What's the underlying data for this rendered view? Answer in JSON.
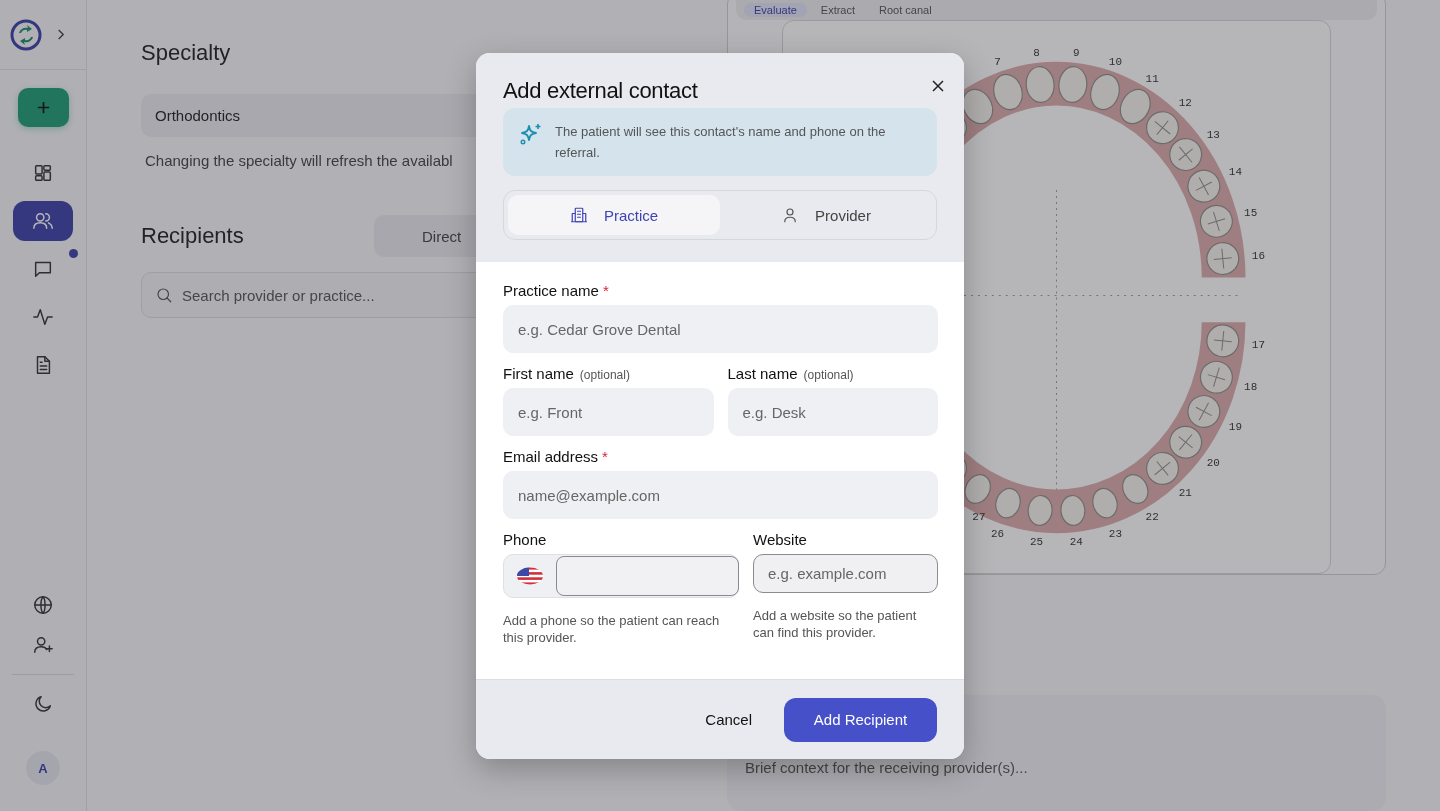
{
  "sidebar": {
    "nav": [
      {
        "kind": "dashboard",
        "selected": false,
        "badge": false
      },
      {
        "kind": "contacts",
        "selected": true,
        "badge": false
      },
      {
        "kind": "messages",
        "selected": false,
        "badge": true
      },
      {
        "kind": "activity",
        "selected": false,
        "badge": false
      },
      {
        "kind": "documents",
        "selected": false,
        "badge": false
      }
    ],
    "utility": [
      {
        "kind": "language"
      },
      {
        "kind": "invite"
      }
    ],
    "avatar": "A"
  },
  "specialty": {
    "title": "Specialty",
    "value": "Orthodontics",
    "help": "Changing the specialty will refresh the availabl"
  },
  "recipients": {
    "title": "Recipients",
    "mode": "Direct",
    "search_placeholder": "Search provider or practice..."
  },
  "treatment_tabs": [
    {
      "label": "Evaluate",
      "selected": true
    },
    {
      "label": "Extract",
      "selected": false
    },
    {
      "label": "Root canal",
      "selected": false
    }
  ],
  "tooth_chart": {
    "upper_numbers": [
      "7",
      "8",
      "9",
      "10",
      "11",
      "12",
      "13",
      "14",
      "15",
      "16"
    ],
    "lower_numbers": [
      "17",
      "18",
      "19",
      "20",
      "21",
      "22",
      "23",
      "24",
      "25",
      "26",
      "27"
    ]
  },
  "notes": {
    "placeholder": "Brief context for the receiving provider(s)..."
  },
  "dialog": {
    "title": "Add external contact",
    "notice": "The patient will see this contact's name and phone on the referral.",
    "required_mark": "*",
    "types": [
      {
        "kind": "practice",
        "label": "Practice",
        "selected": true
      },
      {
        "kind": "provider",
        "label": "Provider",
        "selected": false
      }
    ],
    "rows": [
      [
        {
          "kind": "text",
          "label": "Practice name",
          "required": true,
          "placeholder": "e.g. Cedar Grove Dental"
        }
      ],
      [
        {
          "kind": "text",
          "label": "First name",
          "hint": "(optional)",
          "required": false,
          "placeholder": "e.g. Front"
        },
        {
          "kind": "text",
          "label": "Last name",
          "hint": "(optional)",
          "required": false,
          "placeholder": "e.g. Desk"
        }
      ],
      [
        {
          "kind": "text",
          "label": "Email address",
          "required": true,
          "placeholder": "name@example.com"
        }
      ],
      [
        {
          "kind": "phone",
          "label": "Phone",
          "required": false,
          "help": "Add a phone so the patient can reach this provider."
        },
        {
          "kind": "url",
          "label": "Website",
          "required": false,
          "placeholder": "e.g. example.com",
          "help": "Add a website so the patient can find this provider."
        }
      ]
    ],
    "cancel": "Cancel",
    "submit": "Add Recipient"
  }
}
